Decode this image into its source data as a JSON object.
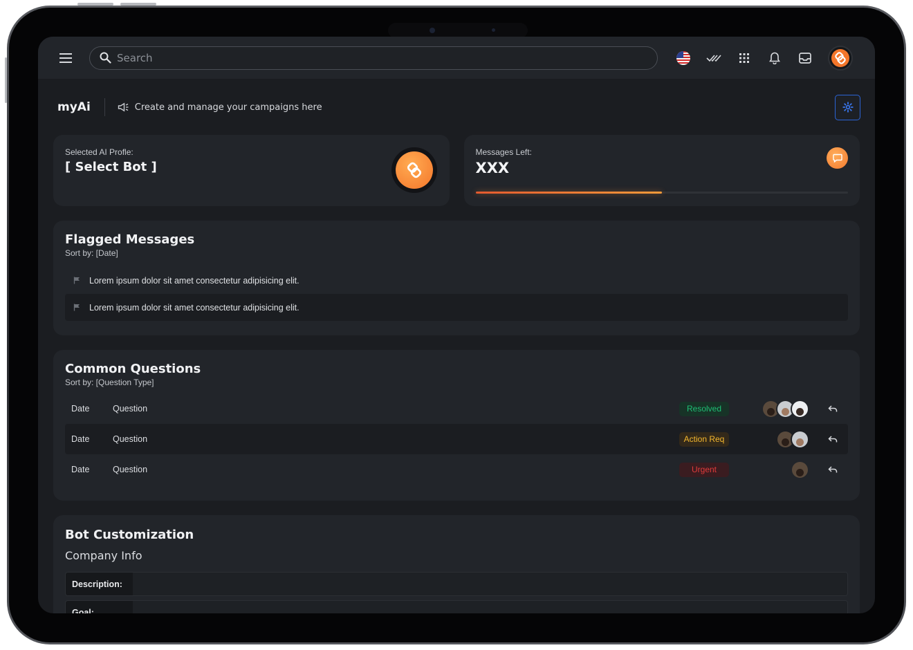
{
  "topbar": {
    "search_placeholder": "Search"
  },
  "header": {
    "title": "myAi",
    "subtitle": "Create and manage your campaigns here"
  },
  "profile_card": {
    "label": "Selected AI Profle:",
    "value": "[ Select Bot ]"
  },
  "messages_card": {
    "label": "Messages Left:",
    "value": "XXX",
    "progress_fraction": 0.5
  },
  "flagged": {
    "title": "Flagged Messages",
    "sort": "Sort by: [Date]",
    "items": [
      "Lorem ipsum dolor sit amet consectetur adipisicing elit.",
      "Lorem ipsum dolor sit amet consectetur adipisicing elit."
    ]
  },
  "questions": {
    "title": "Common Questions",
    "sort": "Sort by: [Question Type]",
    "rows": [
      {
        "date": "Date",
        "question": "Question",
        "status": "Resolved",
        "avatar_count": 3
      },
      {
        "date": "Date",
        "question": "Question",
        "status": "Action Req",
        "avatar_count": 2
      },
      {
        "date": "Date",
        "question": "Question",
        "status": "Urgent",
        "avatar_count": 1
      }
    ]
  },
  "customization": {
    "title": "Bot Customization",
    "section": "Company Info",
    "fields": [
      {
        "label": "Description:",
        "value": ""
      },
      {
        "label": "Goal:",
        "value": ""
      }
    ]
  },
  "colors": {
    "accent_orange": "#f4762a",
    "settings_border": "#2c64d6",
    "resolved": "#1fbf75",
    "action_required": "#f5b82e",
    "urgent": "#e23b3b"
  },
  "icons": [
    "menu-icon",
    "search-icon",
    "us-flag-icon",
    "double-check-icon",
    "apps-grid-icon",
    "bell-icon",
    "inbox-icon",
    "megaphone-icon",
    "gear-icon",
    "chat-icon",
    "flag-icon",
    "reply-icon"
  ]
}
